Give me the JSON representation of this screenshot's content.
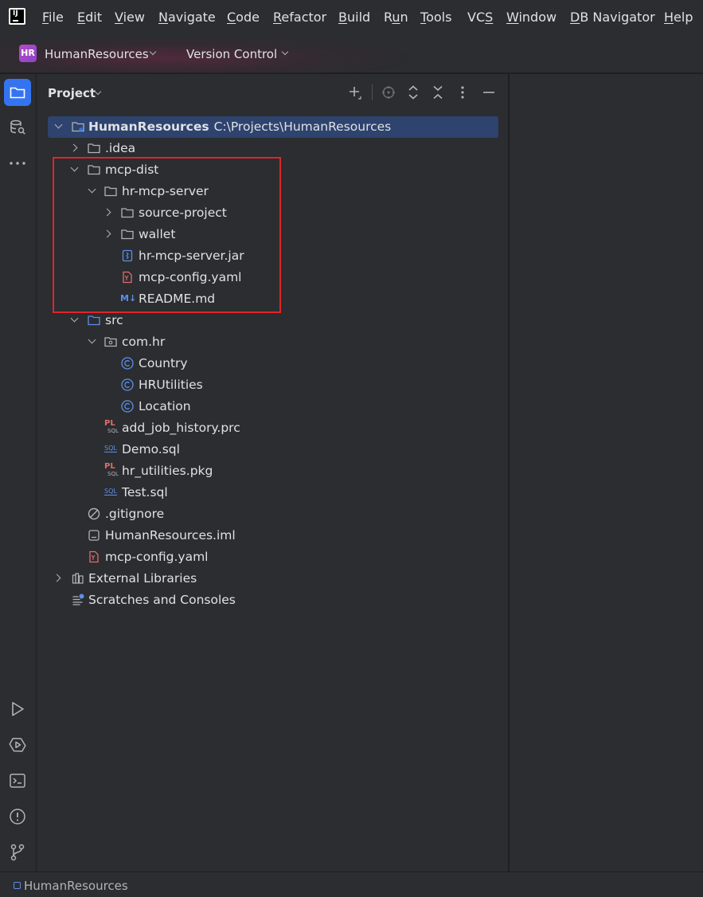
{
  "menubar": {
    "items": [
      {
        "label": "File",
        "mnemonic": "F",
        "rest": "ile"
      },
      {
        "label": "Edit",
        "mnemonic": "E",
        "rest": "dit"
      },
      {
        "label": "View",
        "mnemonic": "V",
        "rest": "iew"
      },
      {
        "label": "Navigate",
        "mnemonic": "N",
        "rest": "avigate"
      },
      {
        "label": "Code",
        "mnemonic": "C",
        "rest": "ode"
      },
      {
        "label": "Refactor",
        "mnemonic": "R",
        "rest": "efactor"
      },
      {
        "label": "Build",
        "mnemonic": "B",
        "rest": "uild"
      },
      {
        "label": "Run",
        "mnemonic": "R",
        "rest": "un",
        "pre": "",
        "mnemonic_index": 1
      },
      {
        "label": "Tools",
        "mnemonic": "T",
        "rest": "ools"
      },
      {
        "label": "VCS",
        "mnemonic": "S",
        "pre": "VC",
        "rest": ""
      },
      {
        "label": "Window",
        "mnemonic": "W",
        "rest": "indow"
      },
      {
        "label": "DB Navigator",
        "mnemonic": "D",
        "rest": "B Navigator"
      },
      {
        "label": "Help",
        "mnemonic": "H",
        "rest": "elp"
      }
    ]
  },
  "titlebar": {
    "project_badge": "HR",
    "project_name": "HumanResources",
    "vcs_label": "Version Control"
  },
  "panel": {
    "title": "Project"
  },
  "tree": {
    "root": {
      "name": "HumanResources",
      "path": "C:\\Projects\\HumanResources"
    },
    "idea": ".idea",
    "mcp_dist": "mcp-dist",
    "hr_mcp_server": "hr-mcp-server",
    "source_project": "source-project",
    "wallet": "wallet",
    "jar": "hr-mcp-server.jar",
    "mcp_config_inner": "mcp-config.yaml",
    "readme": "README.md",
    "src": "src",
    "com_hr": "com.hr",
    "country": "Country",
    "hrutilities": "HRUtilities",
    "location": "Location",
    "add_job_history": "add_job_history.prc",
    "demo_sql": "Demo.sql",
    "hr_utilities_pkg": "hr_utilities.pkg",
    "test_sql": "Test.sql",
    "gitignore": ".gitignore",
    "iml": "HumanResources.iml",
    "mcp_config_root": "mcp-config.yaml",
    "external_libraries": "External Libraries",
    "scratches": "Scratches and Consoles"
  },
  "icon_glyphs": {
    "class": "C",
    "plsql_top": "PL",
    "plsql_bottom": "SQL",
    "sql": "SQL",
    "markdown": "M↓"
  },
  "statusbar": {
    "project": "HumanResources"
  },
  "colors": {
    "accent": "#3574f0",
    "selection": "#2e436e",
    "highlight_box": "#e0242b",
    "background": "#2b2d30"
  }
}
